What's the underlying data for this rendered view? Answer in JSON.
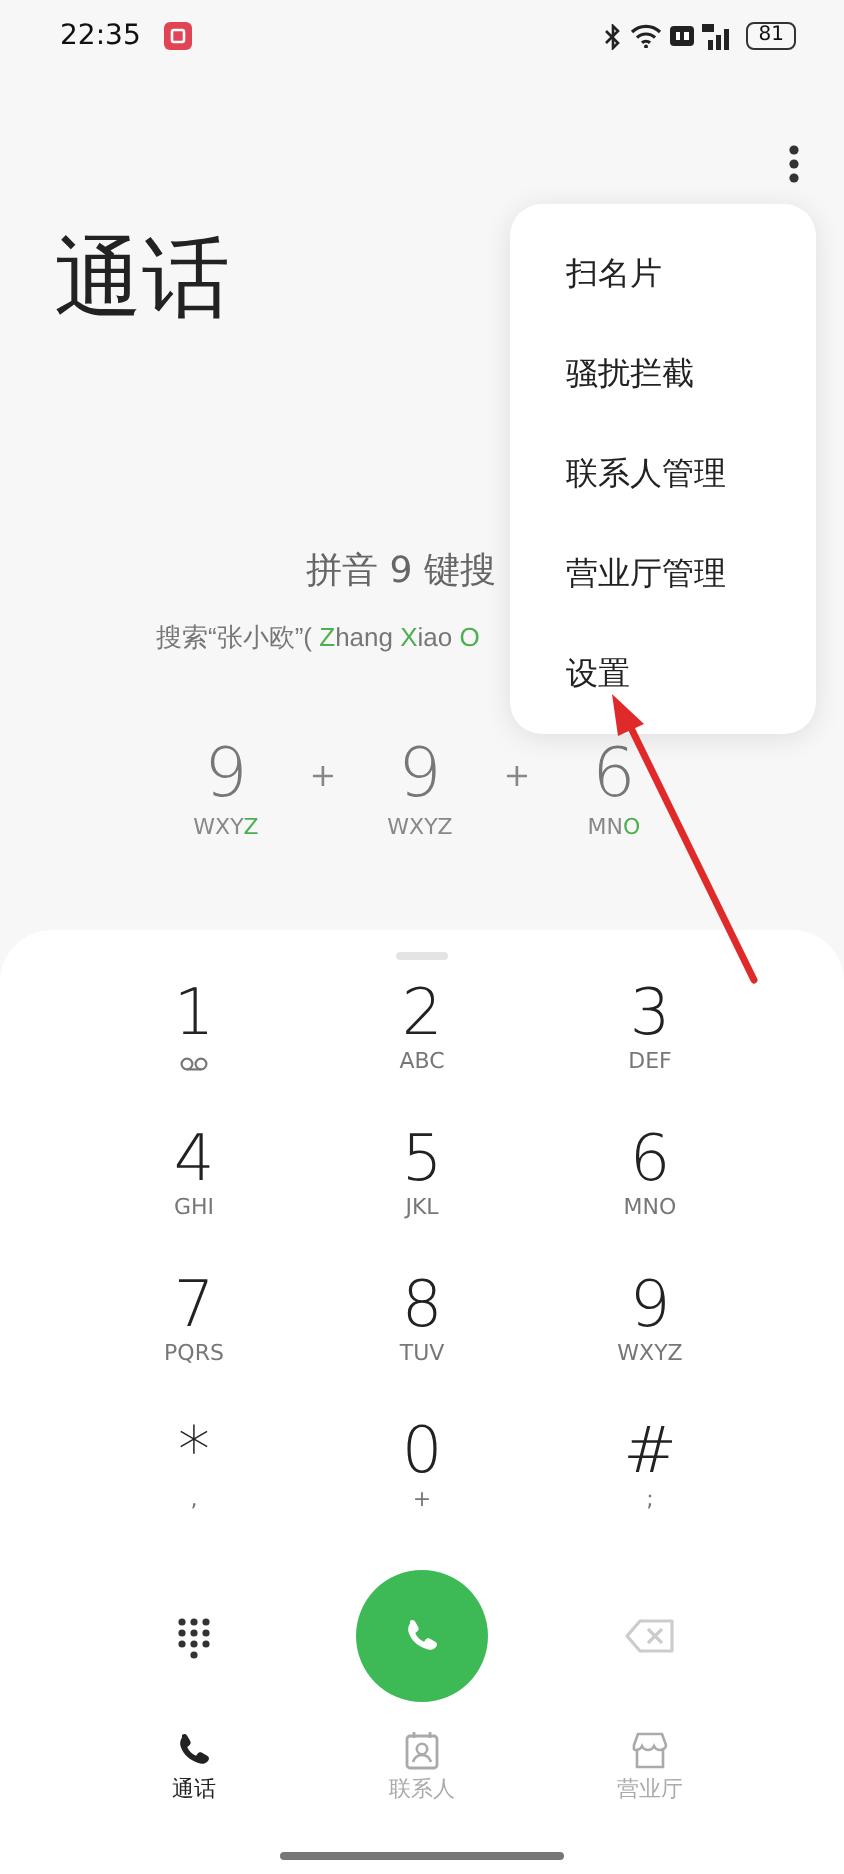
{
  "status_bar": {
    "time": "22:35",
    "battery": "81"
  },
  "title": "通话",
  "hint": {
    "heading": "拼音 9 键搜",
    "example": [
      {
        "text": "搜索“张小欧”( ",
        "highlight": false
      },
      {
        "text": "Z",
        "highlight": true
      },
      {
        "text": "hang ",
        "highlight": false
      },
      {
        "text": "X",
        "highlight": true
      },
      {
        "text": "iao ",
        "highlight": false
      },
      {
        "text": "O",
        "highlight": true
      }
    ],
    "sequence": [
      {
        "digit": "9",
        "letters": [
          {
            "text": "WXY",
            "highlight": false
          },
          {
            "text": "Z",
            "highlight": true
          }
        ]
      },
      {
        "digit": "9",
        "letters": [
          {
            "text": "WXYZ",
            "highlight": false
          }
        ]
      },
      {
        "digit": "6",
        "letters": [
          {
            "text": "MN",
            "highlight": false
          },
          {
            "text": "O",
            "highlight": true
          }
        ]
      }
    ],
    "joiner": [
      "+",
      "+"
    ]
  },
  "menu": [
    "扫名片",
    "骚扰拦截",
    "联系人管理",
    "营业厅管理",
    "设置"
  ],
  "keypad": [
    {
      "digit": "1",
      "kind": "voicemail"
    },
    {
      "digit": "2",
      "sub": "ABC",
      "kind": "letters"
    },
    {
      "digit": "3",
      "sub": "DEF",
      "kind": "letters"
    },
    {
      "digit": "4",
      "sub": "GHI",
      "kind": "letters"
    },
    {
      "digit": "5",
      "sub": "JKL",
      "kind": "letters"
    },
    {
      "digit": "6",
      "sub": "MNO",
      "kind": "letters"
    },
    {
      "digit": "7",
      "sub": "PQRS",
      "kind": "letters"
    },
    {
      "digit": "8",
      "sub": "TUV",
      "kind": "letters"
    },
    {
      "digit": "9",
      "sub": "WXYZ",
      "kind": "letters"
    },
    {
      "digit": "*",
      "sub": ",",
      "kind": "letters"
    },
    {
      "digit": "0",
      "sub": "+",
      "kind": "letters"
    },
    {
      "digit": "#",
      "sub": ";",
      "kind": "letters"
    }
  ],
  "nav": [
    {
      "label": "通话",
      "kind": "calls",
      "selected": true
    },
    {
      "label": "联系人",
      "kind": "contacts",
      "selected": false
    },
    {
      "label": "营业厅",
      "kind": "store",
      "selected": false
    }
  ]
}
